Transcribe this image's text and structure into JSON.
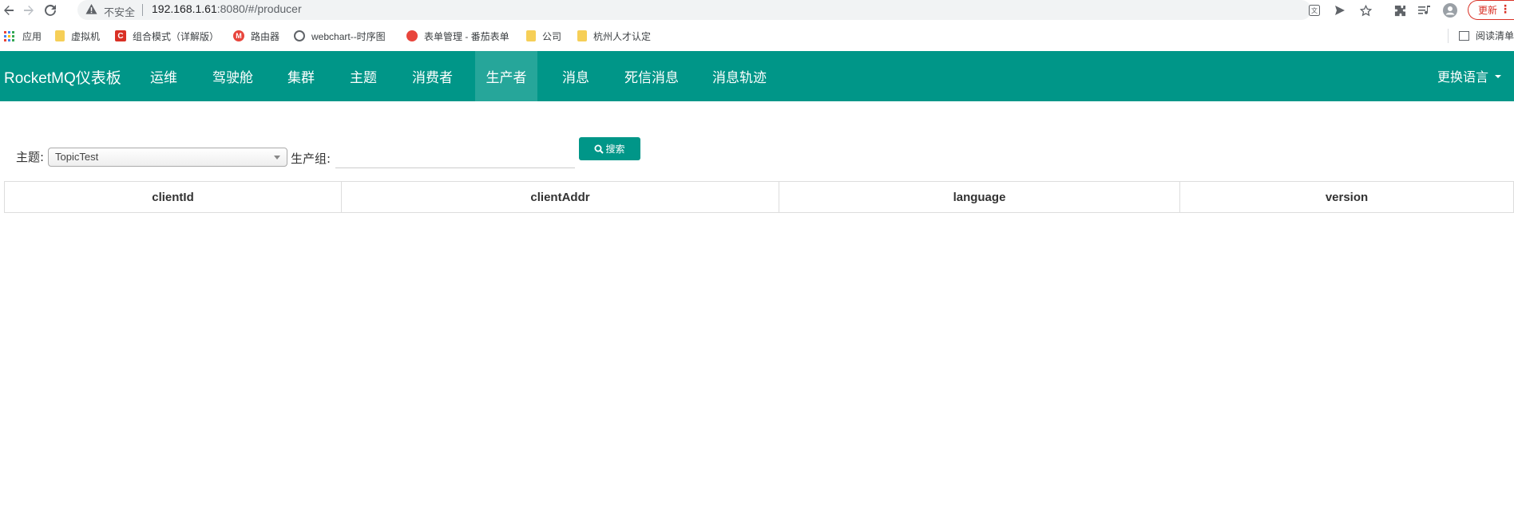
{
  "browser": {
    "insecure_label": "不安全",
    "url_host": "192.168.1.61",
    "url_rest": ":8080/#/producer",
    "update_label": "更新"
  },
  "bookmarks": {
    "items": [
      {
        "label": "应用",
        "icon": "apps-grid-icon"
      },
      {
        "label": "虚拟机",
        "icon": "folder-icon"
      },
      {
        "label": "组合模式（详解版）",
        "icon": "c-logo-icon"
      },
      {
        "label": "路由器",
        "icon": "m-logo-icon"
      },
      {
        "label": "webchart--时序图",
        "icon": "globe-icon"
      },
      {
        "label": "表单管理 - 番茄表单",
        "icon": "tomato-icon"
      },
      {
        "label": "公司",
        "icon": "folder-icon"
      },
      {
        "label": "杭州人才认定",
        "icon": "folder-icon"
      }
    ],
    "reading_list": "阅读清单"
  },
  "header": {
    "brand": "RocketMQ仪表板",
    "nav": [
      "运维",
      "驾驶舱",
      "集群",
      "主题",
      "消费者",
      "生产者",
      "消息",
      "死信消息",
      "消息轨迹"
    ],
    "active_nav": "生产者",
    "language_switch": "更换语言"
  },
  "search": {
    "topic_label": "主题:",
    "topic_value": "TopicTest",
    "group_label": "生产组:",
    "group_value": "",
    "search_button": "搜索"
  },
  "table": {
    "columns": [
      "clientId",
      "clientAddr",
      "language",
      "version"
    ],
    "rows": []
  },
  "colors": {
    "primary": "#009688",
    "active_nav": "#26a69a",
    "update_red": "#d93025"
  }
}
